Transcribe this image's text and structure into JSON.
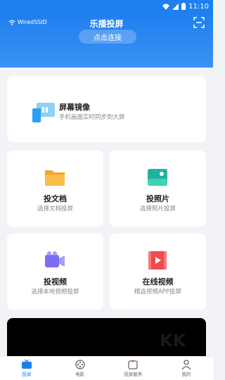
{
  "status_bar": {
    "time": "11:10"
  },
  "header": {
    "wifi_name": "WiredSSID",
    "title": "乐播投屏",
    "connect_label": "点击连接"
  },
  "mirror_card": {
    "title": "屏幕镜像",
    "subtitle": "手机画面实时同步到大屏"
  },
  "grid": [
    {
      "title": "投文档",
      "subtitle": "选择文档投屏",
      "icon": "folder-icon",
      "color": "#f7a22c"
    },
    {
      "title": "投照片",
      "subtitle": "选择照片投屏",
      "icon": "photo-icon",
      "color": "#20b39a"
    },
    {
      "title": "投视频",
      "subtitle": "选择本地视频投屏",
      "icon": "video-camera-icon",
      "color": "#7b6ff0"
    },
    {
      "title": "在线视频",
      "subtitle": "精选视频APP投屏",
      "icon": "film-icon",
      "color": "#ef4b4b"
    }
  ],
  "tabbar": {
    "items": [
      {
        "label": "投屏",
        "icon": "tv-icon"
      },
      {
        "label": "电影",
        "icon": "film-reel-icon"
      },
      {
        "label": "投屏服务",
        "icon": "service-icon"
      },
      {
        "label": "我的",
        "icon": "person-icon"
      }
    ],
    "active_index": 0
  },
  "watermark_text": "KK下载",
  "colors": {
    "accent": "#1e7ff0",
    "background": "#f2f3f7"
  }
}
